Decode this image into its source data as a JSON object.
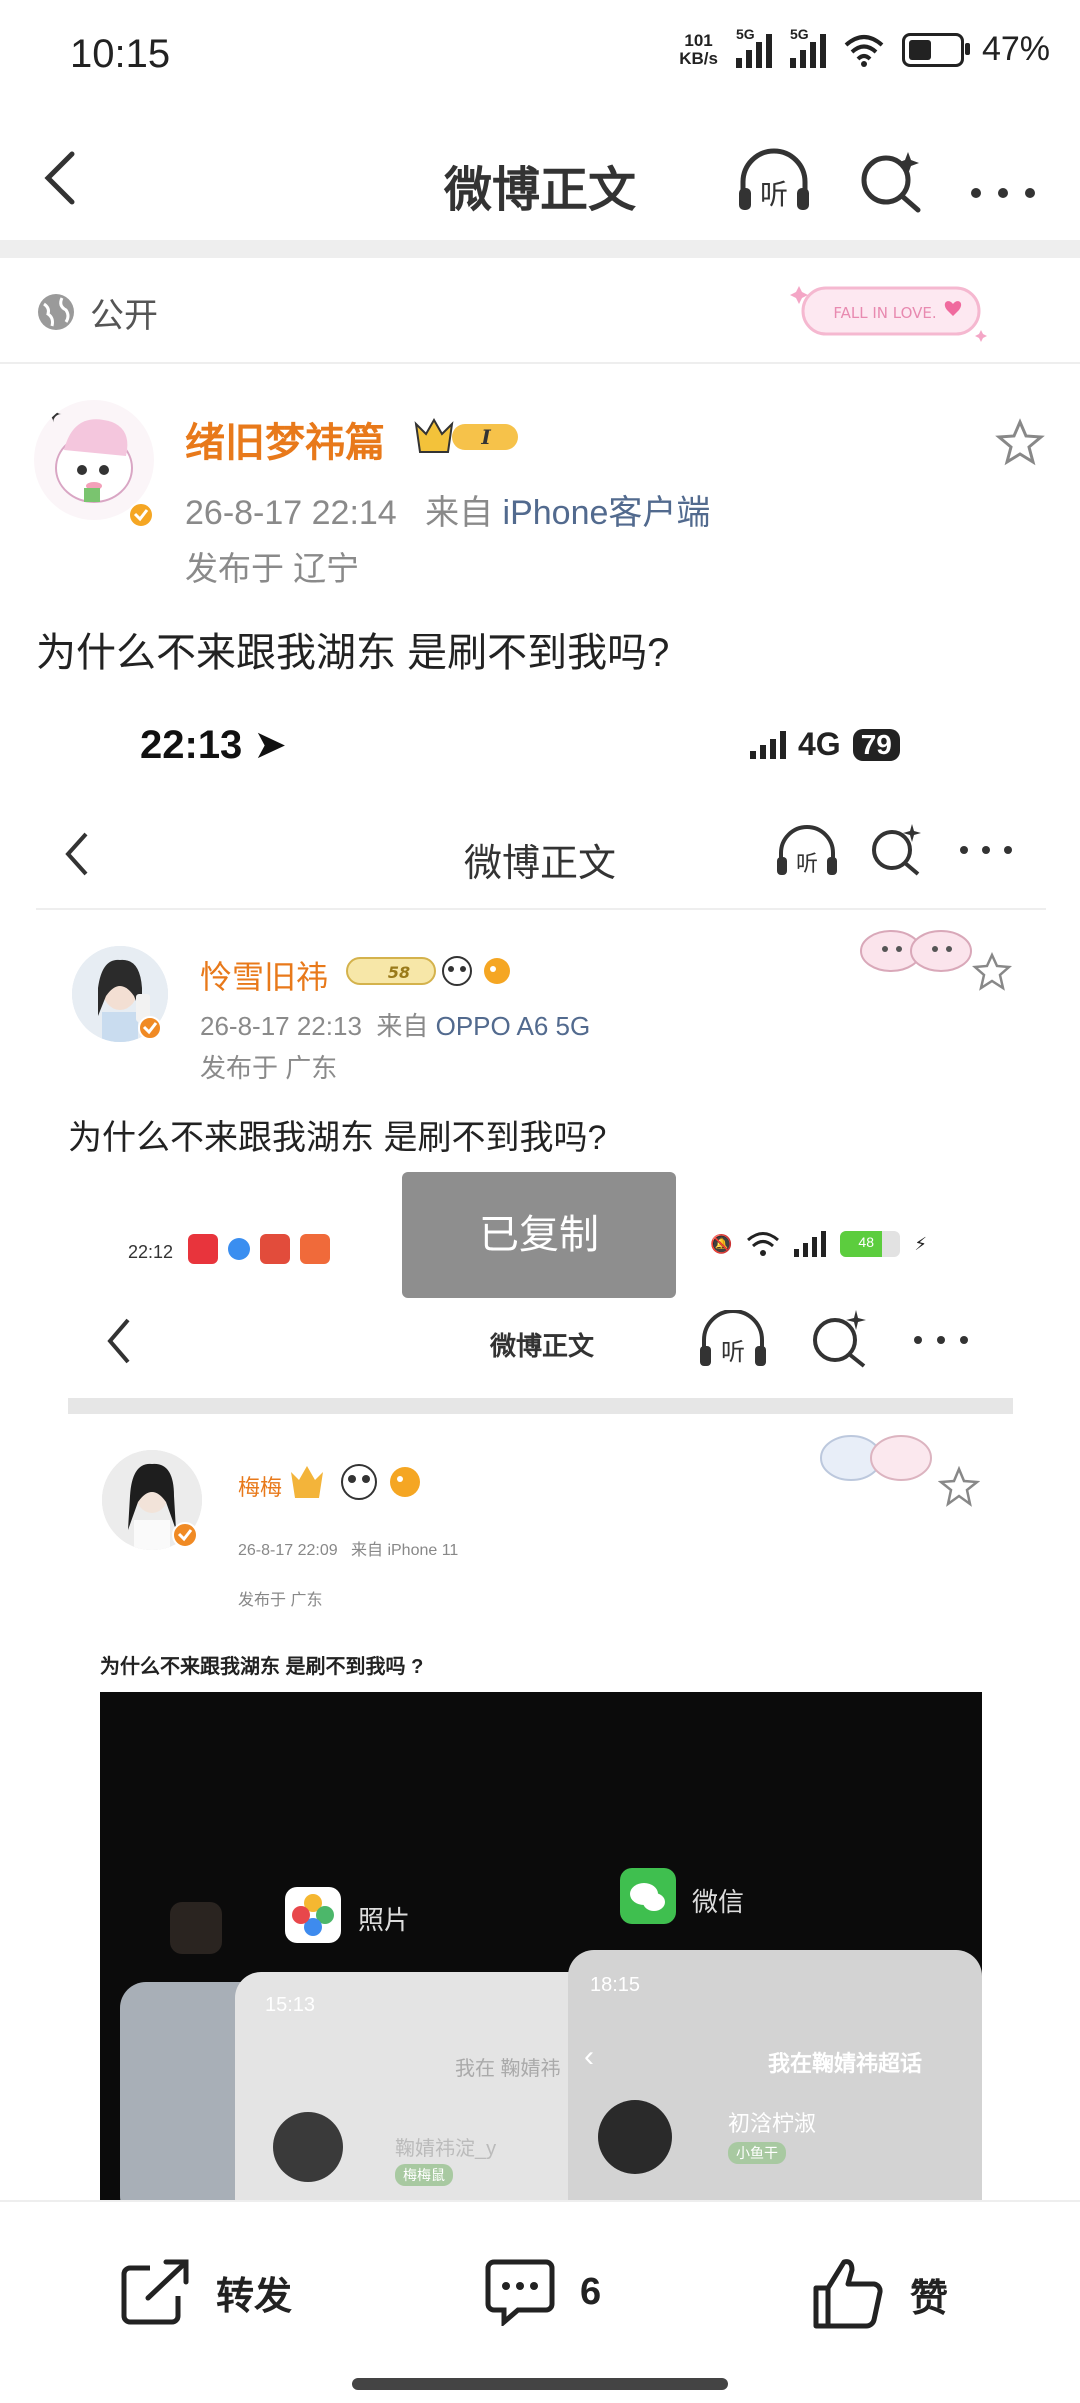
{
  "status_bar": {
    "time": "10:15",
    "net_speed_top": "101",
    "net_speed_bottom": "KB/s",
    "sim1": "5G",
    "sim2": "5G",
    "battery": "47%"
  },
  "nav": {
    "title": "微博正文",
    "listen_icon": "headphones-listen-icon",
    "search_icon": "search-sparkle-icon",
    "more_icon": "more-dots-icon"
  },
  "visibility": {
    "label": "公开",
    "badge_text": "FALL IN LOVE."
  },
  "post": {
    "username": "绪旧梦祎篇",
    "level": "I",
    "timestamp": "26-8-17 22:14",
    "source_prefix": "来自",
    "source": "iPhone客户端",
    "location": "发布于 辽宁",
    "text": "为什么不来跟我湖东 是刷不到我吗?"
  },
  "screenshot1": {
    "time": "22:13",
    "network": "4G",
    "battery": "79",
    "nav_title": "微博正文",
    "username": "怜雪旧祎",
    "badge_level": "58",
    "timestamp": "26-8-17 22:13",
    "source_prefix": "来自",
    "source": "OPPO A6 5G",
    "location": "发布于 广东",
    "text": "为什么不来跟我湖东 是刷不到我吗?"
  },
  "toast": {
    "text": "已复制"
  },
  "screenshot2": {
    "time": "22:12",
    "battery": "48",
    "nav_title": "微博正文",
    "username": "梅梅",
    "timestamp": "26-8-17 22:09",
    "source_prefix": "来自",
    "source": "iPhone 11",
    "location": "发布于 广东",
    "text": "为什么不来跟我湖东 是刷不到我吗 ?",
    "photo": {
      "app1_label": "照片",
      "app2_label": "微信",
      "card1_time": "15:13",
      "card1_header": "我在 鞠婧祎",
      "card1_name": "鞠婧祎淀_y",
      "card1_tag": "梅梅鼠",
      "card2_time": "18:15",
      "card2_header": "我在鞠婧祎超话",
      "card2_name": "初浛柠淑",
      "card2_tag": "小鱼干"
    }
  },
  "bottom_bar": {
    "repost_label": "转发",
    "comment_count": "6",
    "like_label": "赞"
  },
  "colors": {
    "username": "#e8791a",
    "source_link": "#526a8e",
    "meta_gray": "#8a8a8a"
  }
}
